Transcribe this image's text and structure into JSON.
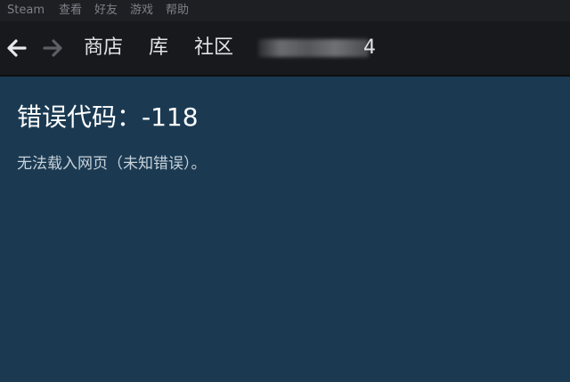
{
  "menu": {
    "items": [
      {
        "label": "Steam"
      },
      {
        "label": "查看"
      },
      {
        "label": "好友"
      },
      {
        "label": "游戏"
      },
      {
        "label": "帮助"
      }
    ]
  },
  "nav": {
    "back_icon": "arrow-left-icon",
    "forward_icon": "arrow-right-icon",
    "store_label": "商店",
    "library_label": "库",
    "community_label": "社区",
    "username_visible_tail": "4"
  },
  "error": {
    "title": "错误代码：-118",
    "message": "无法载入网页（未知错误）。"
  },
  "colors": {
    "menubar_bg": "#1e1f23",
    "navbar_bg": "#18191d",
    "content_bg": "#1b3a52",
    "nav_text": "#dfe3e6"
  }
}
